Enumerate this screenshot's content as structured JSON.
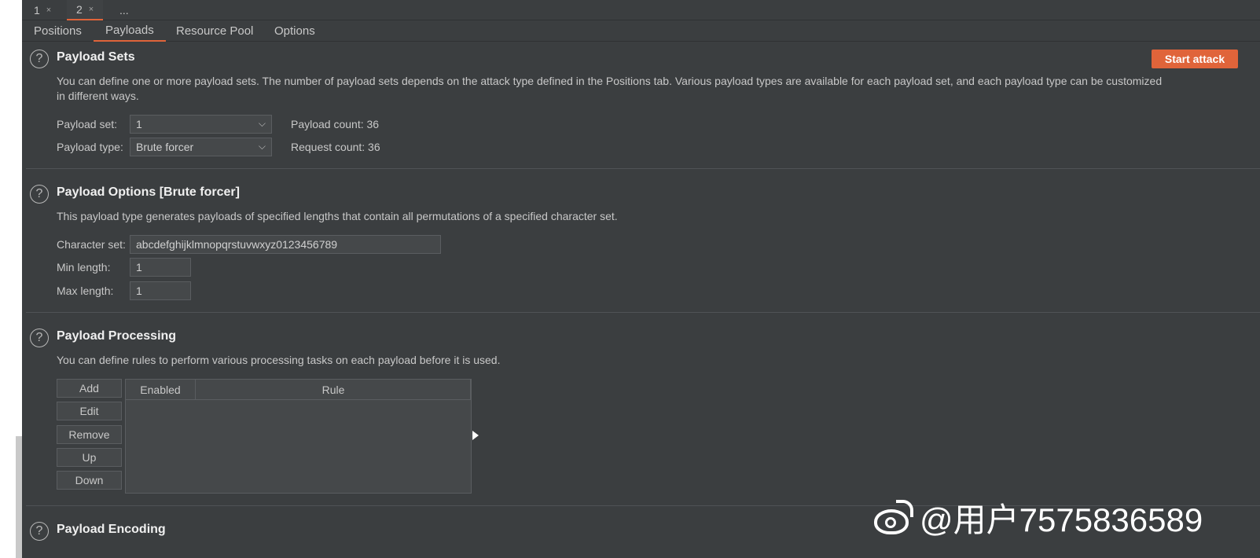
{
  "instance_tabs": [
    {
      "label": "1",
      "close": "×"
    },
    {
      "label": "2",
      "close": "×"
    },
    {
      "label": "..."
    }
  ],
  "sub_tabs": [
    "Positions",
    "Payloads",
    "Resource Pool",
    "Options"
  ],
  "start_attack_label": "Start attack",
  "payload_sets": {
    "title": "Payload Sets",
    "desc_line1": "You can define one or more payload sets. The number of payload sets depends on the attack type defined in the Positions tab. Various payload types are available for each payload set, and each payload type can be customized",
    "desc_line2": "in different ways.",
    "set_label": "Payload set:",
    "set_value": "1",
    "type_label": "Payload type:",
    "type_value": "Brute forcer",
    "payload_count": "Payload count: 36",
    "request_count": "Request count: 36"
  },
  "payload_options": {
    "title": "Payload Options [Brute forcer]",
    "desc": "This payload type generates payloads of specified lengths that contain all permutations of a specified character set.",
    "charset_label": "Character set:",
    "charset_value": "abcdefghijklmnopqrstuvwxyz0123456789",
    "min_label": "Min length:",
    "min_value": "1",
    "max_label": "Max length:",
    "max_value": "1"
  },
  "payload_processing": {
    "title": "Payload Processing",
    "desc": "You can define rules to perform various processing tasks on each payload before it is used.",
    "buttons": [
      "Add",
      "Edit",
      "Remove",
      "Up",
      "Down"
    ],
    "columns": [
      "Enabled",
      "Rule"
    ]
  },
  "payload_encoding": {
    "title": "Payload Encoding"
  },
  "help_glyph": "?",
  "chevron_glyph": "⌵",
  "watermark_text": "@用户7575836589",
  "colors": {
    "accent": "#e0643a",
    "background": "#3b3e40"
  }
}
